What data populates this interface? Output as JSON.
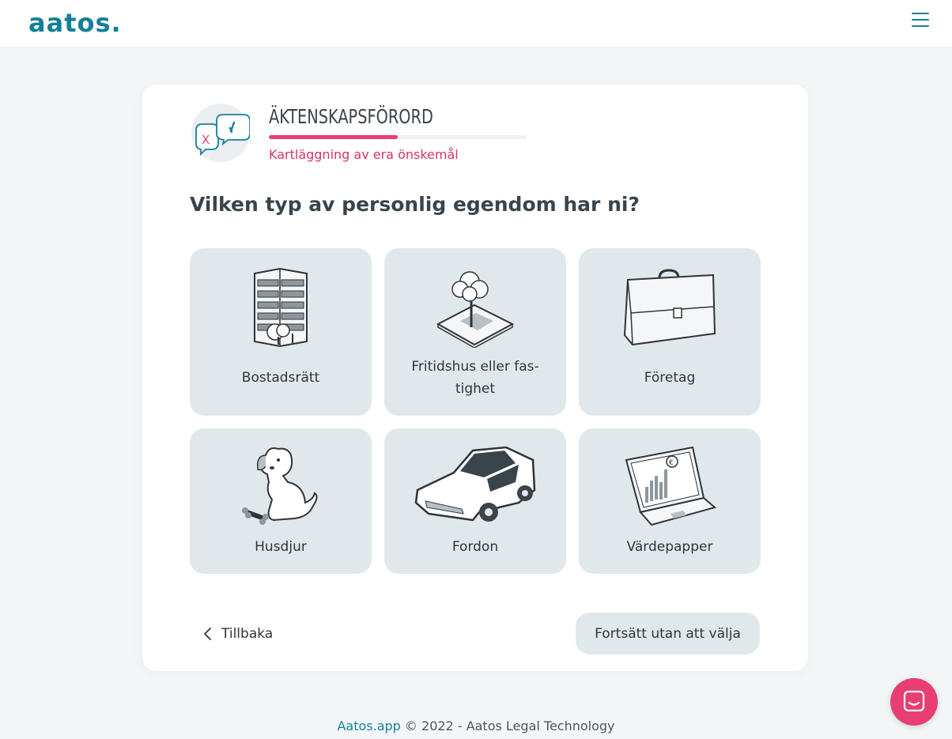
{
  "header": {
    "logo": "aatos.",
    "menu_icon": "hamburger-menu-icon"
  },
  "section": {
    "title": "ÄKTENSKAPSFÖRORD",
    "subtitle": "Kartläggning av era önskemål",
    "progress": 0.5,
    "badge_icon": "speech-bubbles-check-cross-icon"
  },
  "question": "Vilken typ av personlig egendom har ni?",
  "options": [
    {
      "label": "Bostadsrätt",
      "icon": "apartment-building-icon"
    },
    {
      "label": "Fritidshus eller fas-\ntighet",
      "icon": "tree-plot-icon"
    },
    {
      "label": "Företag",
      "icon": "briefcase-icon"
    },
    {
      "label": "Husdjur",
      "icon": "dog-icon"
    },
    {
      "label": "Fordon",
      "icon": "car-icon"
    },
    {
      "label": "Värdepapper",
      "icon": "laptop-chart-icon"
    }
  ],
  "nav": {
    "back_label": "Tillbaka",
    "skip_label": "Fortsätt utan att välja"
  },
  "footer": {
    "link": "Aatos.app",
    "text": " © 2022 - Aatos Legal Technology"
  },
  "colors": {
    "brand": "#13809a",
    "accent": "#e73e74",
    "tile": "#e1e8ec"
  }
}
